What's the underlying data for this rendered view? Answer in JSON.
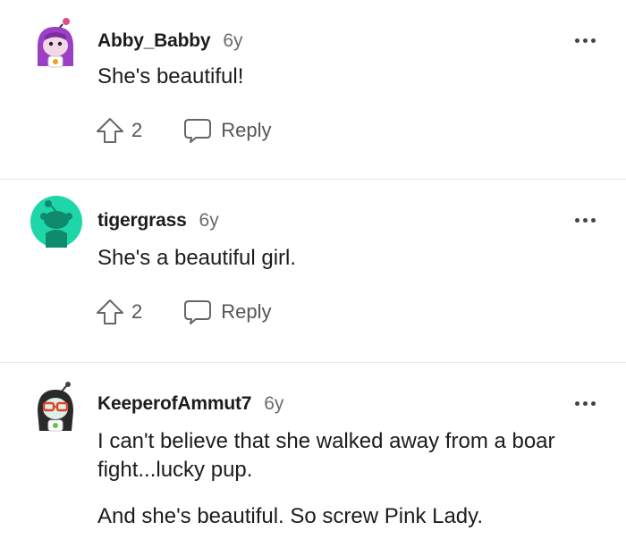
{
  "comments": [
    {
      "username": "Abby_Babby",
      "age": "6y",
      "paragraphs": [
        "She's beautiful!"
      ],
      "upvotes": "2",
      "reply_label": "Reply",
      "avatar_icon": "purple-hair-avatar-icon"
    },
    {
      "username": "tigergrass",
      "age": "6y",
      "paragraphs": [
        "She's a beautiful girl."
      ],
      "upvotes": "2",
      "reply_label": "Reply",
      "avatar_icon": "default-snoo-avatar-icon"
    },
    {
      "username": "KeeperofAmmut7",
      "age": "6y",
      "paragraphs": [
        "I can't believe that she walked away from a boar fight...lucky pup.",
        "And she's beautiful. So screw Pink Lady."
      ],
      "avatar_icon": "glasses-avatar-icon"
    }
  ],
  "colors": {
    "accent_teal": "#1fd6a8",
    "avatar_purple": "#9b3fc4",
    "text": "#1c1c1c",
    "muted": "#6b6b6b"
  }
}
